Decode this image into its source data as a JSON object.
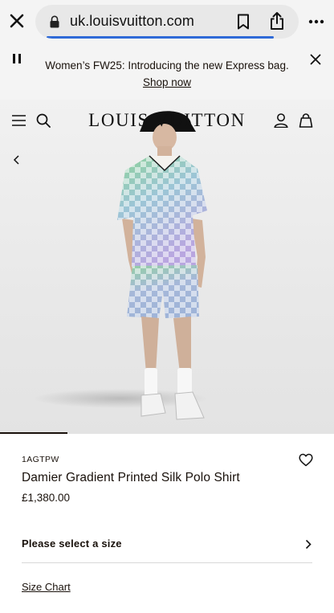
{
  "browser": {
    "url": "uk.louisvuitton.com",
    "icons": [
      "close-icon",
      "lock-icon",
      "bookmark-icon",
      "share-icon",
      "more-icon"
    ],
    "progress_color": "#2f6ad7"
  },
  "promo": {
    "text": "Women’s FW25: Introducing the new Express bag.",
    "link_text": "Shop now"
  },
  "header": {
    "logo": "LOUIS VUITTON"
  },
  "product": {
    "sku": "1AGTPW",
    "name": "Damier Gradient Printed Silk Polo Shirt",
    "price": "£1,380.00",
    "size_select_label": "Please select a size",
    "size_chart_label": "Size Chart"
  }
}
